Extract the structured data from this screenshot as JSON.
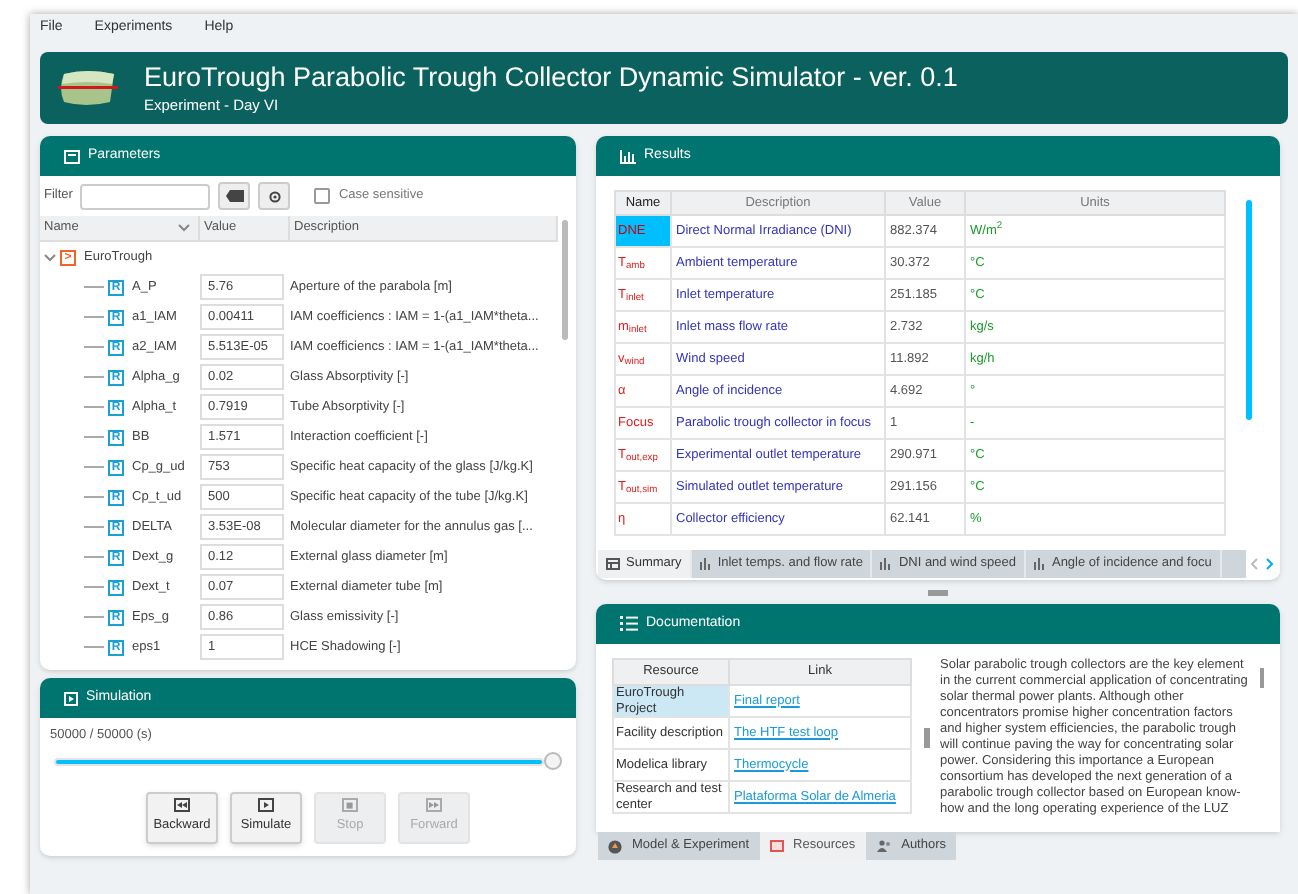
{
  "menu": [
    "File",
    "Experiments",
    "Help"
  ],
  "header": {
    "title": "EuroTrough Parabolic Trough Collector Dynamic Simulator - ver. 0.1",
    "subtitle": "Experiment - Day VI"
  },
  "parameters": {
    "title": "Parameters",
    "filter": {
      "label": "Filter"
    },
    "case_sensitive": {
      "label": "Case sensitive",
      "checked": false
    },
    "columns": [
      "Name",
      "Value",
      "Description"
    ],
    "tree": [
      {
        "name": "EuroTrough",
        "expanded": true,
        "kind": "model",
        "badge": ">",
        "children": [
          {
            "name": "A_P",
            "value": "5.76",
            "description": "Aperture of the parabola [m]",
            "kind": "real",
            "badge": "R"
          },
          {
            "name": "a1_IAM",
            "value": "0.00411",
            "description": "IAM coefficiencs : IAM = 1-(a1_IAM*theta...",
            "kind": "real",
            "badge": "R"
          },
          {
            "name": "a2_IAM",
            "value": "5.513E-05",
            "description": "IAM coefficiencs : IAM = 1-(a1_IAM*theta...",
            "kind": "real",
            "badge": "R"
          },
          {
            "name": "Alpha_g",
            "value": "0.02",
            "description": "Glass Absorptivity [-]",
            "kind": "real",
            "badge": "R"
          },
          {
            "name": "Alpha_t",
            "value": "0.7919",
            "description": "Tube Absorptivity [-]",
            "kind": "real",
            "badge": "R"
          },
          {
            "name": "BB",
            "value": "1.571",
            "description": "Interaction coefficient [-]",
            "kind": "real",
            "badge": "R"
          },
          {
            "name": "Cp_g_ud",
            "value": "753",
            "description": "Specific heat capacity of the glass [J/kg.K]",
            "kind": "real",
            "badge": "R"
          },
          {
            "name": "Cp_t_ud",
            "value": "500",
            "description": "Specific heat capacity of the tube [J/kg.K]",
            "kind": "real",
            "badge": "R"
          },
          {
            "name": "DELTA",
            "value": "3.53E-08",
            "description": "Molecular diameter for the annulus gas [...",
            "kind": "real",
            "badge": "R"
          },
          {
            "name": "Dext_g",
            "value": "0.12",
            "description": "External glass diameter [m]",
            "kind": "real",
            "badge": "R"
          },
          {
            "name": "Dext_t",
            "value": "0.07",
            "description": "External diameter tube [m]",
            "kind": "real",
            "badge": "R"
          },
          {
            "name": "Eps_g",
            "value": "0.86",
            "description": "Glass emissivity [-]",
            "kind": "real",
            "badge": "R"
          },
          {
            "name": "eps1",
            "value": "1",
            "description": "HCE Shadowing [-]",
            "kind": "real",
            "badge": "R"
          }
        ]
      }
    ]
  },
  "simulation": {
    "title": "Simulation",
    "progress": "50000 / 50000  (s)",
    "level": 1,
    "buttons": [
      {
        "label": "Backward",
        "disabled": false,
        "kind": "backward"
      },
      {
        "label": "Simulate",
        "disabled": false,
        "kind": "play"
      },
      {
        "label": "Stop",
        "disabled": true,
        "kind": "stop"
      },
      {
        "label": "Forward",
        "disabled": true,
        "kind": "forward"
      }
    ]
  },
  "results": {
    "title": "Results",
    "columns": [
      "Name",
      "Description",
      "Value",
      "Units"
    ],
    "rows": [
      {
        "name": "DNE",
        "description": "Direct Normal Irradiance (DNI)",
        "value": "882.374",
        "units": "W/m$^{2}$",
        "selected": true
      },
      {
        "name": "T$_{amb}$",
        "description": "Ambient temperature",
        "value": "30.372",
        "units": "°C",
        "selected": false
      },
      {
        "name": "T$_{inlet}$",
        "description": "Inlet temperature",
        "value": "251.185",
        "units": "°C",
        "selected": false
      },
      {
        "name": "m$_{inlet}$",
        "description": "Inlet mass flow rate",
        "value": "2.732",
        "units": "kg/s",
        "selected": false
      },
      {
        "name": "v$_{wind}$",
        "description": "Wind speed",
        "value": "11.892",
        "units": "kg/h",
        "selected": false
      },
      {
        "name": "α",
        "description": "Angle of incidence",
        "value": "4.692",
        "units": "°",
        "selected": false
      },
      {
        "name": "Focus",
        "description": "Parabolic trough collector in focus",
        "value": "1",
        "units": "-",
        "selected": false
      },
      {
        "name": "T$_{out,exp}$",
        "description": "Experimental outlet temperature",
        "value": "290.971",
        "units": "°C",
        "selected": false
      },
      {
        "name": "T$_{out,sim}$",
        "description": "Simulated outlet temperature",
        "value": "291.156",
        "units": "°C",
        "selected": false
      },
      {
        "name": "η",
        "description": "Collector efficiency",
        "value": "62.141",
        "units": "%",
        "selected": false
      }
    ],
    "tabs": [
      {
        "label": "Summary",
        "selected": true,
        "kind": "table"
      },
      {
        "label": "Inlet temps. and flow rate",
        "selected": false,
        "kind": "chart"
      },
      {
        "label": "DNI and wind speed",
        "selected": false,
        "kind": "chart"
      },
      {
        "label": "Angle of incidence and focu",
        "selected": false,
        "kind": "chart"
      }
    ]
  },
  "documentation": {
    "title": "Documentation",
    "columns": [
      "Resource",
      "Link"
    ],
    "rows": [
      {
        "resource": "EuroTrough Project",
        "link": "Final report",
        "selected": true
      },
      {
        "resource": "Facility description",
        "link": "The HTF test loop",
        "selected": false
      },
      {
        "resource": "Modelica library",
        "link": "Thermocycle",
        "selected": false
      },
      {
        "resource": "Research and test center",
        "link": "Plataforma Solar de Almeria",
        "selected": false
      }
    ],
    "text": "Solar parabolic trough collectors are the key element in the current commercial application of concentrating solar thermal power plants. Although other concentrators promise higher concentration factors and higher system efficiencies, the parabolic trough will continue paving the way for concentrating solar power. Considering this importance a European consortium has developed the next generation of a parabolic trough collector based on European know-how and the long operating experience of the LUZ",
    "tabs": [
      {
        "label": "Model & Experiment",
        "selected": false,
        "kind": "model"
      },
      {
        "label": "Resources",
        "selected": true,
        "kind": "resources"
      },
      {
        "label": "Authors",
        "selected": false,
        "kind": "authors"
      }
    ]
  }
}
